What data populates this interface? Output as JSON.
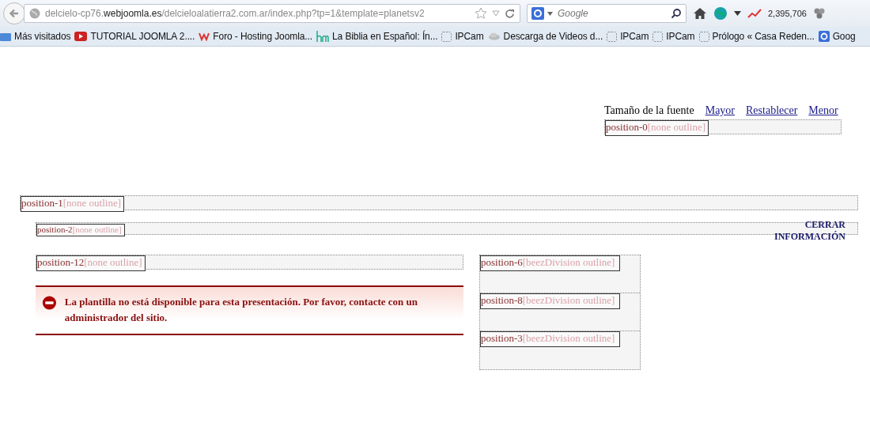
{
  "browser": {
    "url": {
      "host_prefix": "delcielo-cp76.",
      "host": "webjoomla.es",
      "path": "/delcieloalatierra2.com.ar/index.php?tp=1&template=planetsv2"
    },
    "search": {
      "placeholder": "Google"
    },
    "counter": "2,395,706"
  },
  "bookmarks": [
    {
      "label": "Más visitados",
      "kind": "folder"
    },
    {
      "label": "TUTORIAL JOOMLA 2....",
      "kind": "video"
    },
    {
      "label": "Foro - Hosting Joomla...",
      "kind": "w"
    },
    {
      "label": "La Biblia en Español: Ín...",
      "kind": "hm"
    },
    {
      "label": "IPCam",
      "kind": "blank"
    },
    {
      "label": "Descarga de Videos d...",
      "kind": "cloud"
    },
    {
      "label": "IPCam",
      "kind": "blank"
    },
    {
      "label": "IPCam",
      "kind": "blank"
    },
    {
      "label": "Prólogo « Casa Reden...",
      "kind": "blank"
    },
    {
      "label": "Goog",
      "kind": "google"
    }
  ],
  "font_size": {
    "label": "Tamaño de la fuente",
    "links": [
      "Mayor",
      "Restablecer",
      "Menor"
    ]
  },
  "position_0": {
    "name": "position-0",
    "style": "[none outline]"
  },
  "position_1": {
    "name": "position-1",
    "style": "[none outline]"
  },
  "position_2": {
    "name": "position-2",
    "style": "[none outline]"
  },
  "close_info": "CERRAR INFORMACIÓN",
  "position_12": {
    "name": "position-12",
    "style": "[none outline]"
  },
  "error": {
    "message": "La plantilla no está disponible para esta presentación. Por favor, contacte con un administrador del sitio."
  },
  "sidebar": [
    {
      "name": "position-6",
      "style": "[beezDivision outline]"
    },
    {
      "name": "position-8",
      "style": "[beezDivision outline]"
    },
    {
      "name": "position-3",
      "style": "[beezDivision outline]"
    }
  ]
}
